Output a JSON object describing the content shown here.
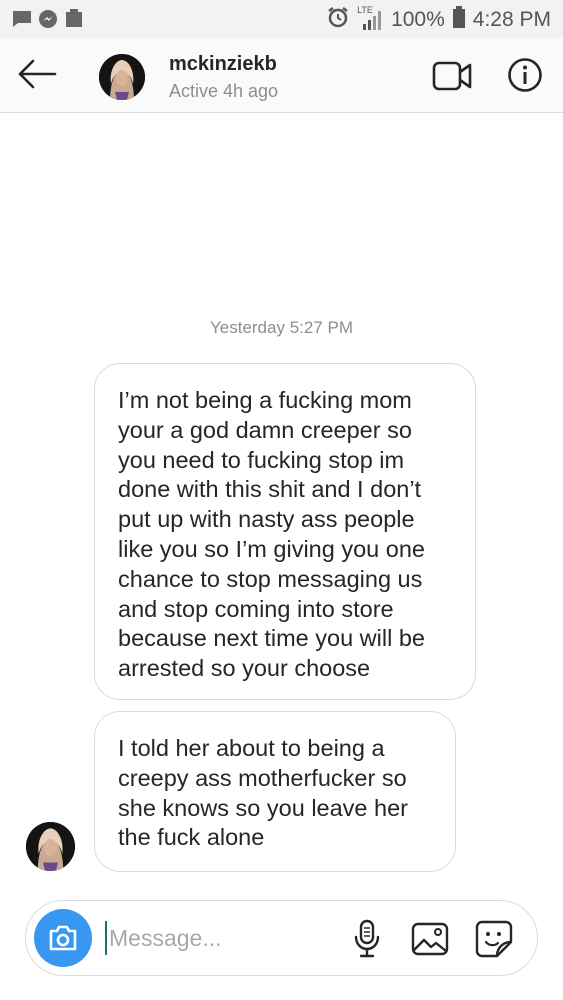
{
  "status_bar": {
    "notification_icons": [
      "chat-bubble-icon",
      "messenger-icon",
      "battery-saver-icon"
    ],
    "network_label": "LTE",
    "battery_percent": "100%",
    "time": "4:28 PM"
  },
  "header": {
    "username": "mckinziekb",
    "active_status": "Active 4h ago"
  },
  "thread": {
    "timestamp": "Yesterday 5:27 PM",
    "messages": [
      {
        "lines": [
          "I’m not being a fucking mom",
          "your a god damn creeper so",
          "you need to fucking stop im",
          "done with this shit and I don’t",
          "put up with nasty ass people",
          "like you so I’m giving you one",
          "chance to stop messaging us",
          "and stop coming into store",
          "because next time you will be",
          "arrested so your choose"
        ]
      },
      {
        "lines": [
          "I told her about to being a",
          "creepy ass motherfucker so",
          "she knows so you leave her",
          "the fuck alone"
        ]
      }
    ]
  },
  "composer": {
    "placeholder": "Message..."
  },
  "colors": {
    "accent": "#3897f0",
    "header_bg": "#fafafa",
    "status_bar_bg": "#f2f2f2",
    "bubble_border": "#dbdbdb",
    "secondary_text": "#8e8e8e"
  }
}
